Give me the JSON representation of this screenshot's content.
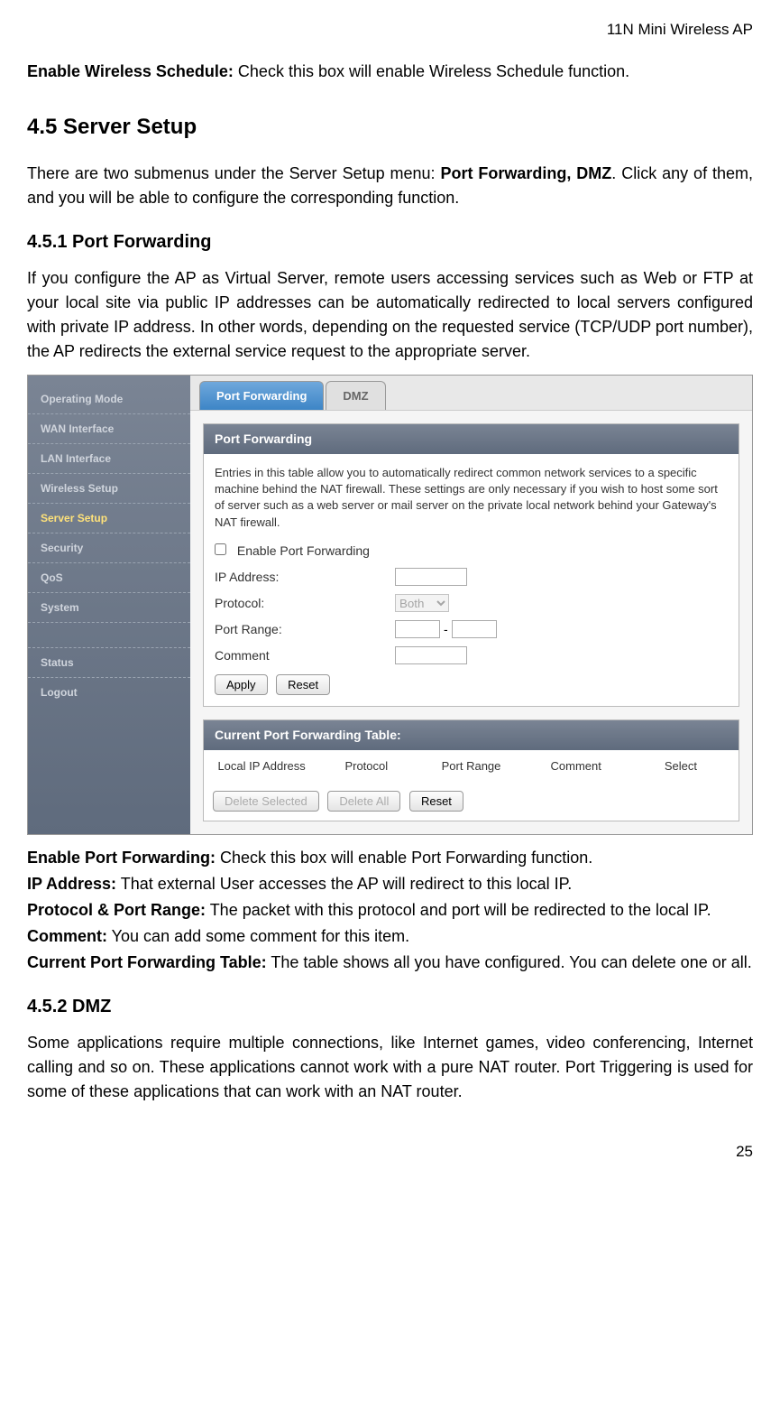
{
  "header": {
    "title": "11N Mini Wireless AP"
  },
  "page_number": "25",
  "intro": {
    "label": "Enable Wireless Schedule:",
    "text": " Check this box will enable Wireless Schedule function."
  },
  "section_45": {
    "heading": "4.5 Server Setup",
    "para_pre": "There are two submenus under the Server Setup menu: ",
    "para_bold": "Port Forwarding, DMZ",
    "para_post": ". Click any of them, and you will be able to configure the corresponding function."
  },
  "section_451": {
    "heading": "4.5.1 Port Forwarding",
    "para": "If you configure the AP as Virtual Server, remote users accessing services such as Web or FTP at your local site via public IP addresses can be automatically redirected to local servers configured with private IP address. In other words, depending on the requested service (TCP/UDP port number), the AP redirects the external service request to the appropriate server."
  },
  "screenshot": {
    "sidebar": {
      "items": [
        "Operating Mode",
        "WAN Interface",
        "LAN Interface",
        "Wireless Setup",
        "Server Setup",
        "Security",
        "QoS",
        "System"
      ],
      "bottom_items": [
        "Status",
        "Logout"
      ]
    },
    "tabs": {
      "active": "Port Forwarding",
      "inactive": "DMZ"
    },
    "panel": {
      "title": "Port Forwarding",
      "desc": "Entries in this table allow you to automatically redirect common network services to a specific machine behind the NAT firewall. These settings are only necessary if you wish to host some sort of server such as a web server or mail server on the private local network behind your Gateway's NAT firewall.",
      "enable_label": "Enable Port Forwarding",
      "ip_label": "IP Address:",
      "protocol_label": "Protocol:",
      "protocol_value": "Both",
      "port_range_label": "Port Range:",
      "comment_label": "Comment",
      "apply_btn": "Apply",
      "reset_btn": "Reset"
    },
    "table": {
      "title": "Current Port Forwarding Table:",
      "cols": [
        "Local IP Address",
        "Protocol",
        "Port Range",
        "Comment",
        "Select"
      ],
      "delete_selected_btn": "Delete Selected",
      "delete_all_btn": "Delete All",
      "reset_btn": "Reset"
    }
  },
  "defs": {
    "enable_pf": {
      "label": "Enable Port Forwarding:",
      "text": " Check this box will enable Port Forwarding function."
    },
    "ip": {
      "label": "IP Address:",
      "text": " That external User accesses the AP will redirect to this local IP."
    },
    "proto": {
      "label": "Protocol & Port Range:",
      "text": " The packet with this protocol and port will be redirected to the local IP."
    },
    "comment": {
      "label": "Comment:",
      "text": " You can add some comment for this item."
    },
    "table": {
      "label": "Current Port Forwarding Table:",
      "text": " The table shows all you have configured. You can delete one or all."
    }
  },
  "section_452": {
    "heading": "4.5.2 DMZ",
    "para": "Some applications require multiple connections, like Internet games, video conferencing, Internet calling and so on. These applications cannot work with a pure NAT router. Port Triggering is used for some of these applications that can work with an NAT router."
  }
}
